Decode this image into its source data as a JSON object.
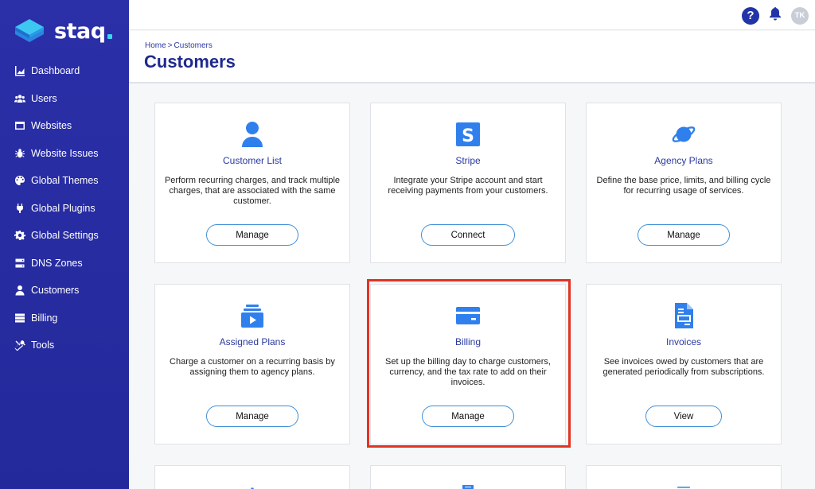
{
  "app": {
    "name": "staq"
  },
  "sidebar": {
    "items": [
      {
        "label": "Dashboard",
        "icon": "chart-area-icon"
      },
      {
        "label": "Users",
        "icon": "users-icon"
      },
      {
        "label": "Websites",
        "icon": "window-icon"
      },
      {
        "label": "Website Issues",
        "icon": "bug-icon"
      },
      {
        "label": "Global Themes",
        "icon": "palette-icon"
      },
      {
        "label": "Global Plugins",
        "icon": "plug-icon"
      },
      {
        "label": "Global Settings",
        "icon": "gear-icon"
      },
      {
        "label": "DNS Zones",
        "icon": "server-icon"
      },
      {
        "label": "Customers",
        "icon": "user-icon"
      },
      {
        "label": "Billing",
        "icon": "list-icon"
      },
      {
        "label": "Tools",
        "icon": "tools-icon"
      }
    ]
  },
  "topbar": {
    "help": "?",
    "avatar_initials": "TK"
  },
  "breadcrumb": {
    "home": "Home",
    "separator": ">",
    "current": "Customers"
  },
  "page": {
    "title": "Customers"
  },
  "cards": [
    {
      "title": "Customer List",
      "description": "Perform recurring charges, and track multiple charges, that are associated with the same customer.",
      "button": "Manage",
      "icon": "user-icon"
    },
    {
      "title": "Stripe",
      "description": "Integrate your Stripe account and start receiving payments from your customers.",
      "button": "Connect",
      "icon": "stripe-icon"
    },
    {
      "title": "Agency Plans",
      "description": "Define the base price, limits, and billing cycle for recurring usage of services.",
      "button": "Manage",
      "icon": "planet-icon"
    },
    {
      "title": "Assigned Plans",
      "description": "Charge a customer on a recurring basis by assigning them to agency plans.",
      "button": "Manage",
      "icon": "media-stack-icon"
    },
    {
      "title": "Billing",
      "description": "Set up the billing day to charge customers, currency, and the tax rate to add on their invoices.",
      "button": "Manage",
      "icon": "credit-card-icon"
    },
    {
      "title": "Invoices",
      "description": "See invoices owed by customers that are generated periodically from subscriptions.",
      "button": "View",
      "icon": "invoice-icon"
    }
  ],
  "colors": {
    "sidebar_bg": "#2b2fa8",
    "accent": "#2b3aa0",
    "icon_blue": "#2f80ed",
    "highlight": "#e23322"
  }
}
